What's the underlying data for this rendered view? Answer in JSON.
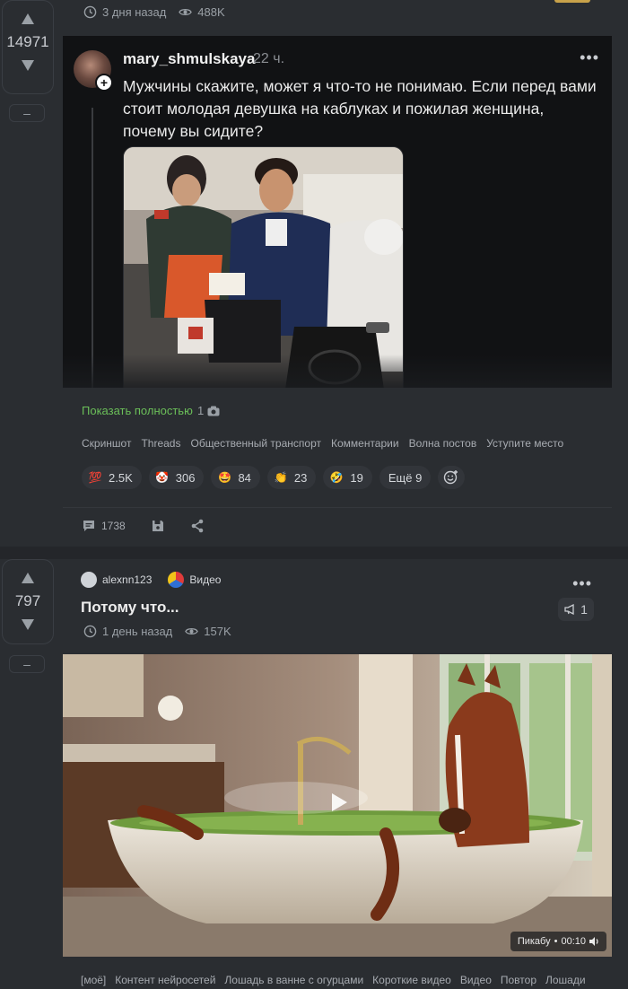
{
  "post1": {
    "meta": {
      "age": "3 дня назад",
      "views": "488K"
    },
    "rating": "14971",
    "minus_label": "–",
    "thread": {
      "username": "mary_shmulskaya",
      "time": "22 ч.",
      "text": "Мужчины скажите, может я что-то не понимаю. Если перед вами стоит молодая девушка на каблуках и пожилая женщина, почему вы сидите?"
    },
    "show_full": "Показать полностью",
    "photo_count": "1",
    "tags": [
      "Скриншот",
      "Threads",
      "Общественный транспорт",
      "Комментарии",
      "Волна постов",
      "Уступите место"
    ],
    "reactions": [
      {
        "emoji": "💯",
        "count": "2.5K",
        "color": "#c0392b"
      },
      {
        "emoji": "🤡",
        "count": "306",
        "color": "#e05a5a"
      },
      {
        "emoji": "🤩",
        "count": "84",
        "color": "#f1c40f"
      },
      {
        "emoji": "👏",
        "count": "23",
        "color": "#f39c12"
      },
      {
        "emoji": "🤣",
        "count": "19",
        "color": "#f1c40f"
      }
    ],
    "reactions_more": "Ещё 9",
    "comments": "1738"
  },
  "post2": {
    "rating": "797",
    "minus_label": "–",
    "author": "alexnn123",
    "community": "Видео",
    "title": "Потому что...",
    "community_count": "1",
    "meta": {
      "age": "1 день назад",
      "views": "157K"
    },
    "video_source": "Пикабу",
    "video_duration": "00:10",
    "tags": [
      "[моё]",
      "Контент нейросетей",
      "Лошадь в ванне с огурцами",
      "Короткие видео",
      "Видео",
      "Повтор",
      "Лошади"
    ]
  },
  "colors": {
    "accent_green": "#6bbf59",
    "bg": "#2a2d31",
    "thread_bg": "#111214"
  }
}
